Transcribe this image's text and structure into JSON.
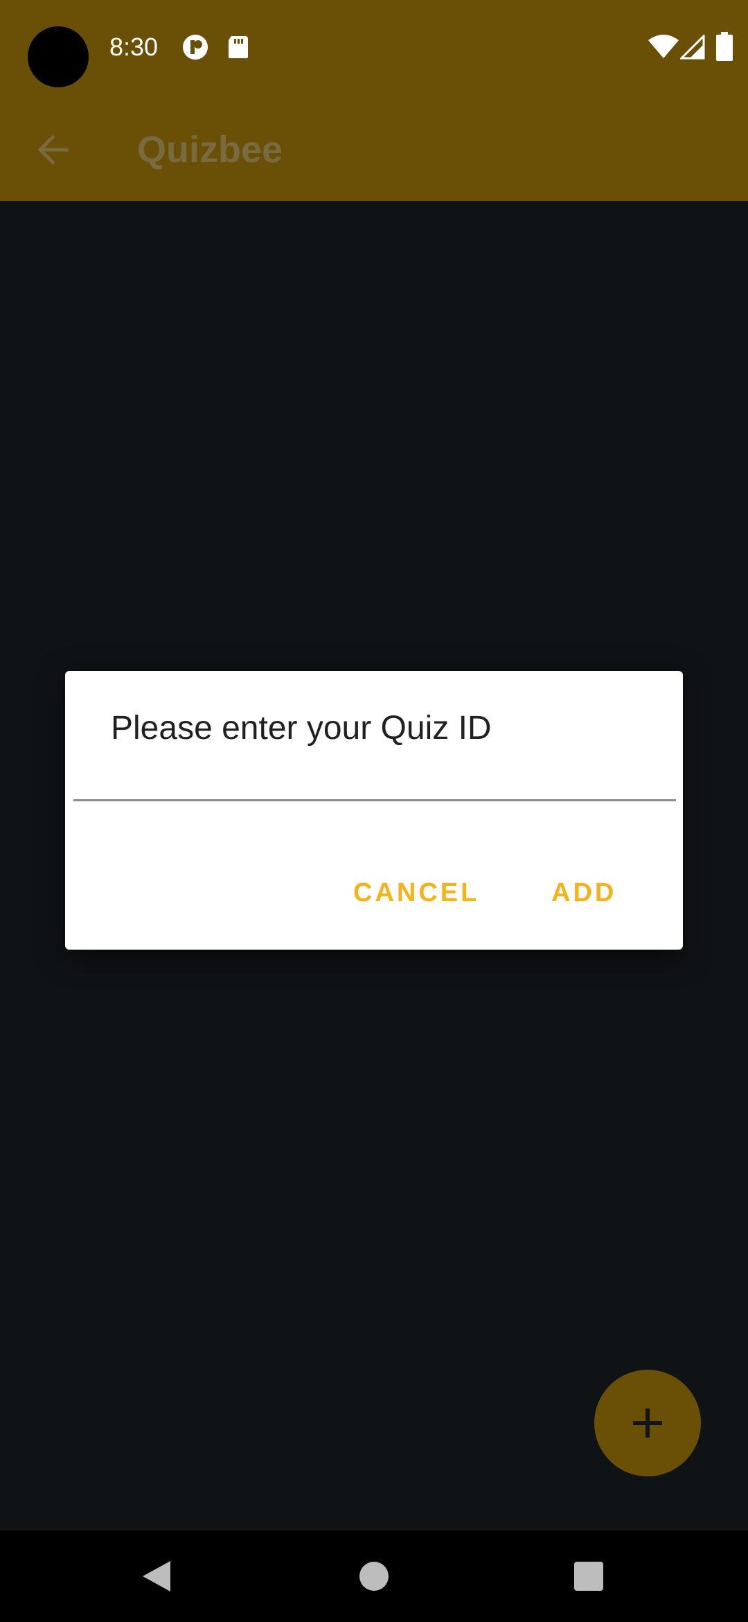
{
  "status_bar": {
    "time": "8:30",
    "icons": [
      "notification-icon",
      "sd-card-icon",
      "wifi-icon",
      "cell-signal-icon",
      "battery-icon"
    ]
  },
  "app_bar": {
    "title": "Quizbee",
    "back_icon": "arrow-back-icon"
  },
  "dialog": {
    "title": "Please enter your Quiz ID",
    "input_value": "",
    "cancel_label": "CANCEL",
    "add_label": "ADD"
  },
  "fab": {
    "icon": "plus-icon"
  },
  "nav_bar": {
    "icons": [
      "nav-back-icon",
      "nav-home-icon",
      "nav-recents-icon"
    ]
  },
  "colors": {
    "app_bar": "#6a4f06",
    "background": "#101316",
    "accent": "#f4b21b",
    "dialog": "#ffffff"
  }
}
